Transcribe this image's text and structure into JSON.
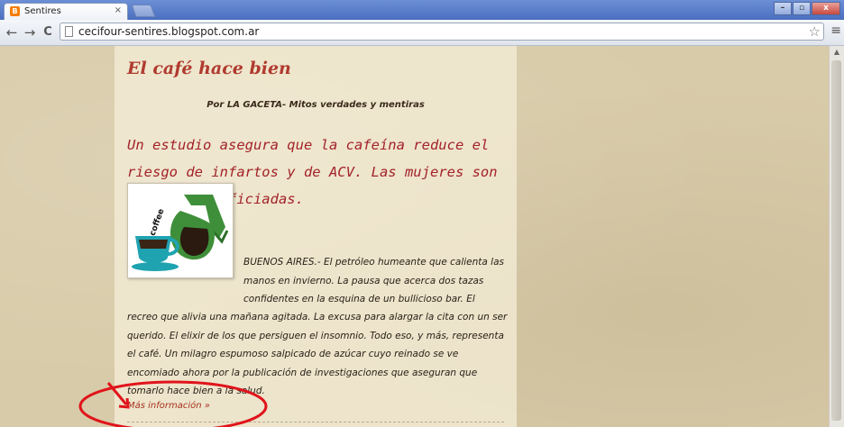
{
  "browser": {
    "tab_title": "Sentires",
    "tab_close": "×",
    "favicon_letter": "B",
    "url": "cecifour-sentires.blogspot.com.ar",
    "back": "←",
    "forward": "→",
    "reload": "C",
    "star": "☆",
    "wrench": "≡",
    "minimize": "–",
    "maximize": "▫",
    "close": "x"
  },
  "post": {
    "title": "El café hace bien",
    "byline": "Por LA GACETA- Mitos verdades y mentiras",
    "headline": "Un estudio asegura que la cafeína reduce el riesgo de infartos y de ACV. Las mujeres son las más beneficiadas.",
    "body_intro": "BUENOS AIRES.-  El petróleo humeante que calienta las manos en invierno. La pausa que acerca dos tazas confidentes en la esquina de un bullicioso bar. El",
    "body_rest": "recreo que alivia una mañana agitada. La excusa para alargar la cita con un ser querido. El elixir de los que persiguen el insomnio. Todo eso, y más, representa el café. Un milagro espumoso salpicado de azúcar cuyo reinado se ve encomiado ahora por la publicación de investigaciones que aseguran que tomarlo hace bien a la salud.",
    "more_link": "Más información »",
    "image_text": "coffee"
  },
  "colors": {
    "title": "#b03a2e",
    "headline": "#a3222a",
    "annotation": "#e0141b",
    "cup": "#1fa3b0",
    "pot": "#3f8f3a"
  }
}
